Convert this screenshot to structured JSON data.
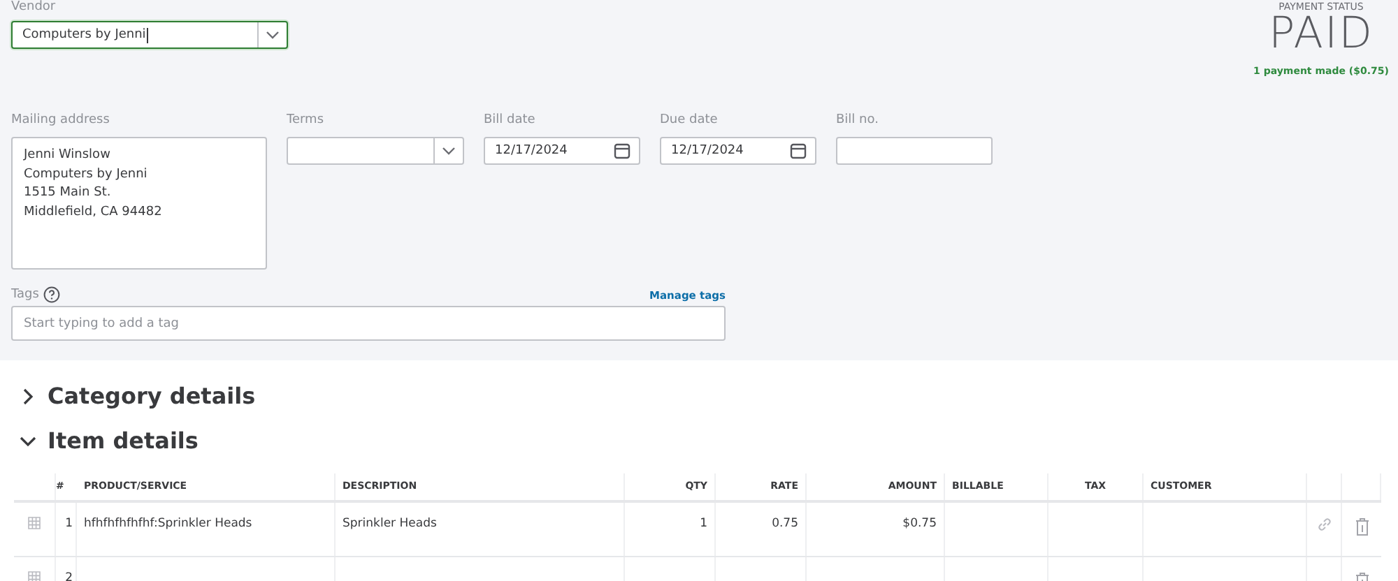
{
  "vendor": {
    "label": "Vendor",
    "value": "Computers by Jenni"
  },
  "payment_status": {
    "label": "PAYMENT STATUS",
    "status": "PAID",
    "note": "1 payment made ($0.75)"
  },
  "mailing_address": {
    "label": "Mailing address",
    "lines": [
      "Jenni Winslow",
      "Computers by Jenni",
      "1515 Main St.",
      "Middlefield, CA  94482"
    ]
  },
  "terms": {
    "label": "Terms"
  },
  "bill_date": {
    "label": "Bill date",
    "value": "12/17/2024"
  },
  "due_date": {
    "label": "Due date",
    "value": "12/17/2024"
  },
  "bill_no": {
    "label": "Bill no."
  },
  "tags": {
    "label": "Tags",
    "manage_link": "Manage tags",
    "placeholder": "Start typing to add a tag"
  },
  "sections": [
    {
      "title": "Category details",
      "expanded": false
    },
    {
      "title": "Item details",
      "expanded": true
    }
  ],
  "table": {
    "columns": [
      "#",
      "PRODUCT/SERVICE",
      "DESCRIPTION",
      "QTY",
      "RATE",
      "AMOUNT",
      "BILLABLE",
      "TAX",
      "CUSTOMER"
    ],
    "rows": [
      {
        "number": "1",
        "product": "hfhfhfhfhfhf:Sprinkler Heads",
        "description": "Sprinkler Heads",
        "qty": "1",
        "rate": "0.75",
        "amount": "$0.75",
        "linkable": true
      },
      {
        "number": "2",
        "product": "",
        "description": "",
        "qty": "",
        "rate": "",
        "amount": "",
        "linkable": false
      }
    ]
  }
}
